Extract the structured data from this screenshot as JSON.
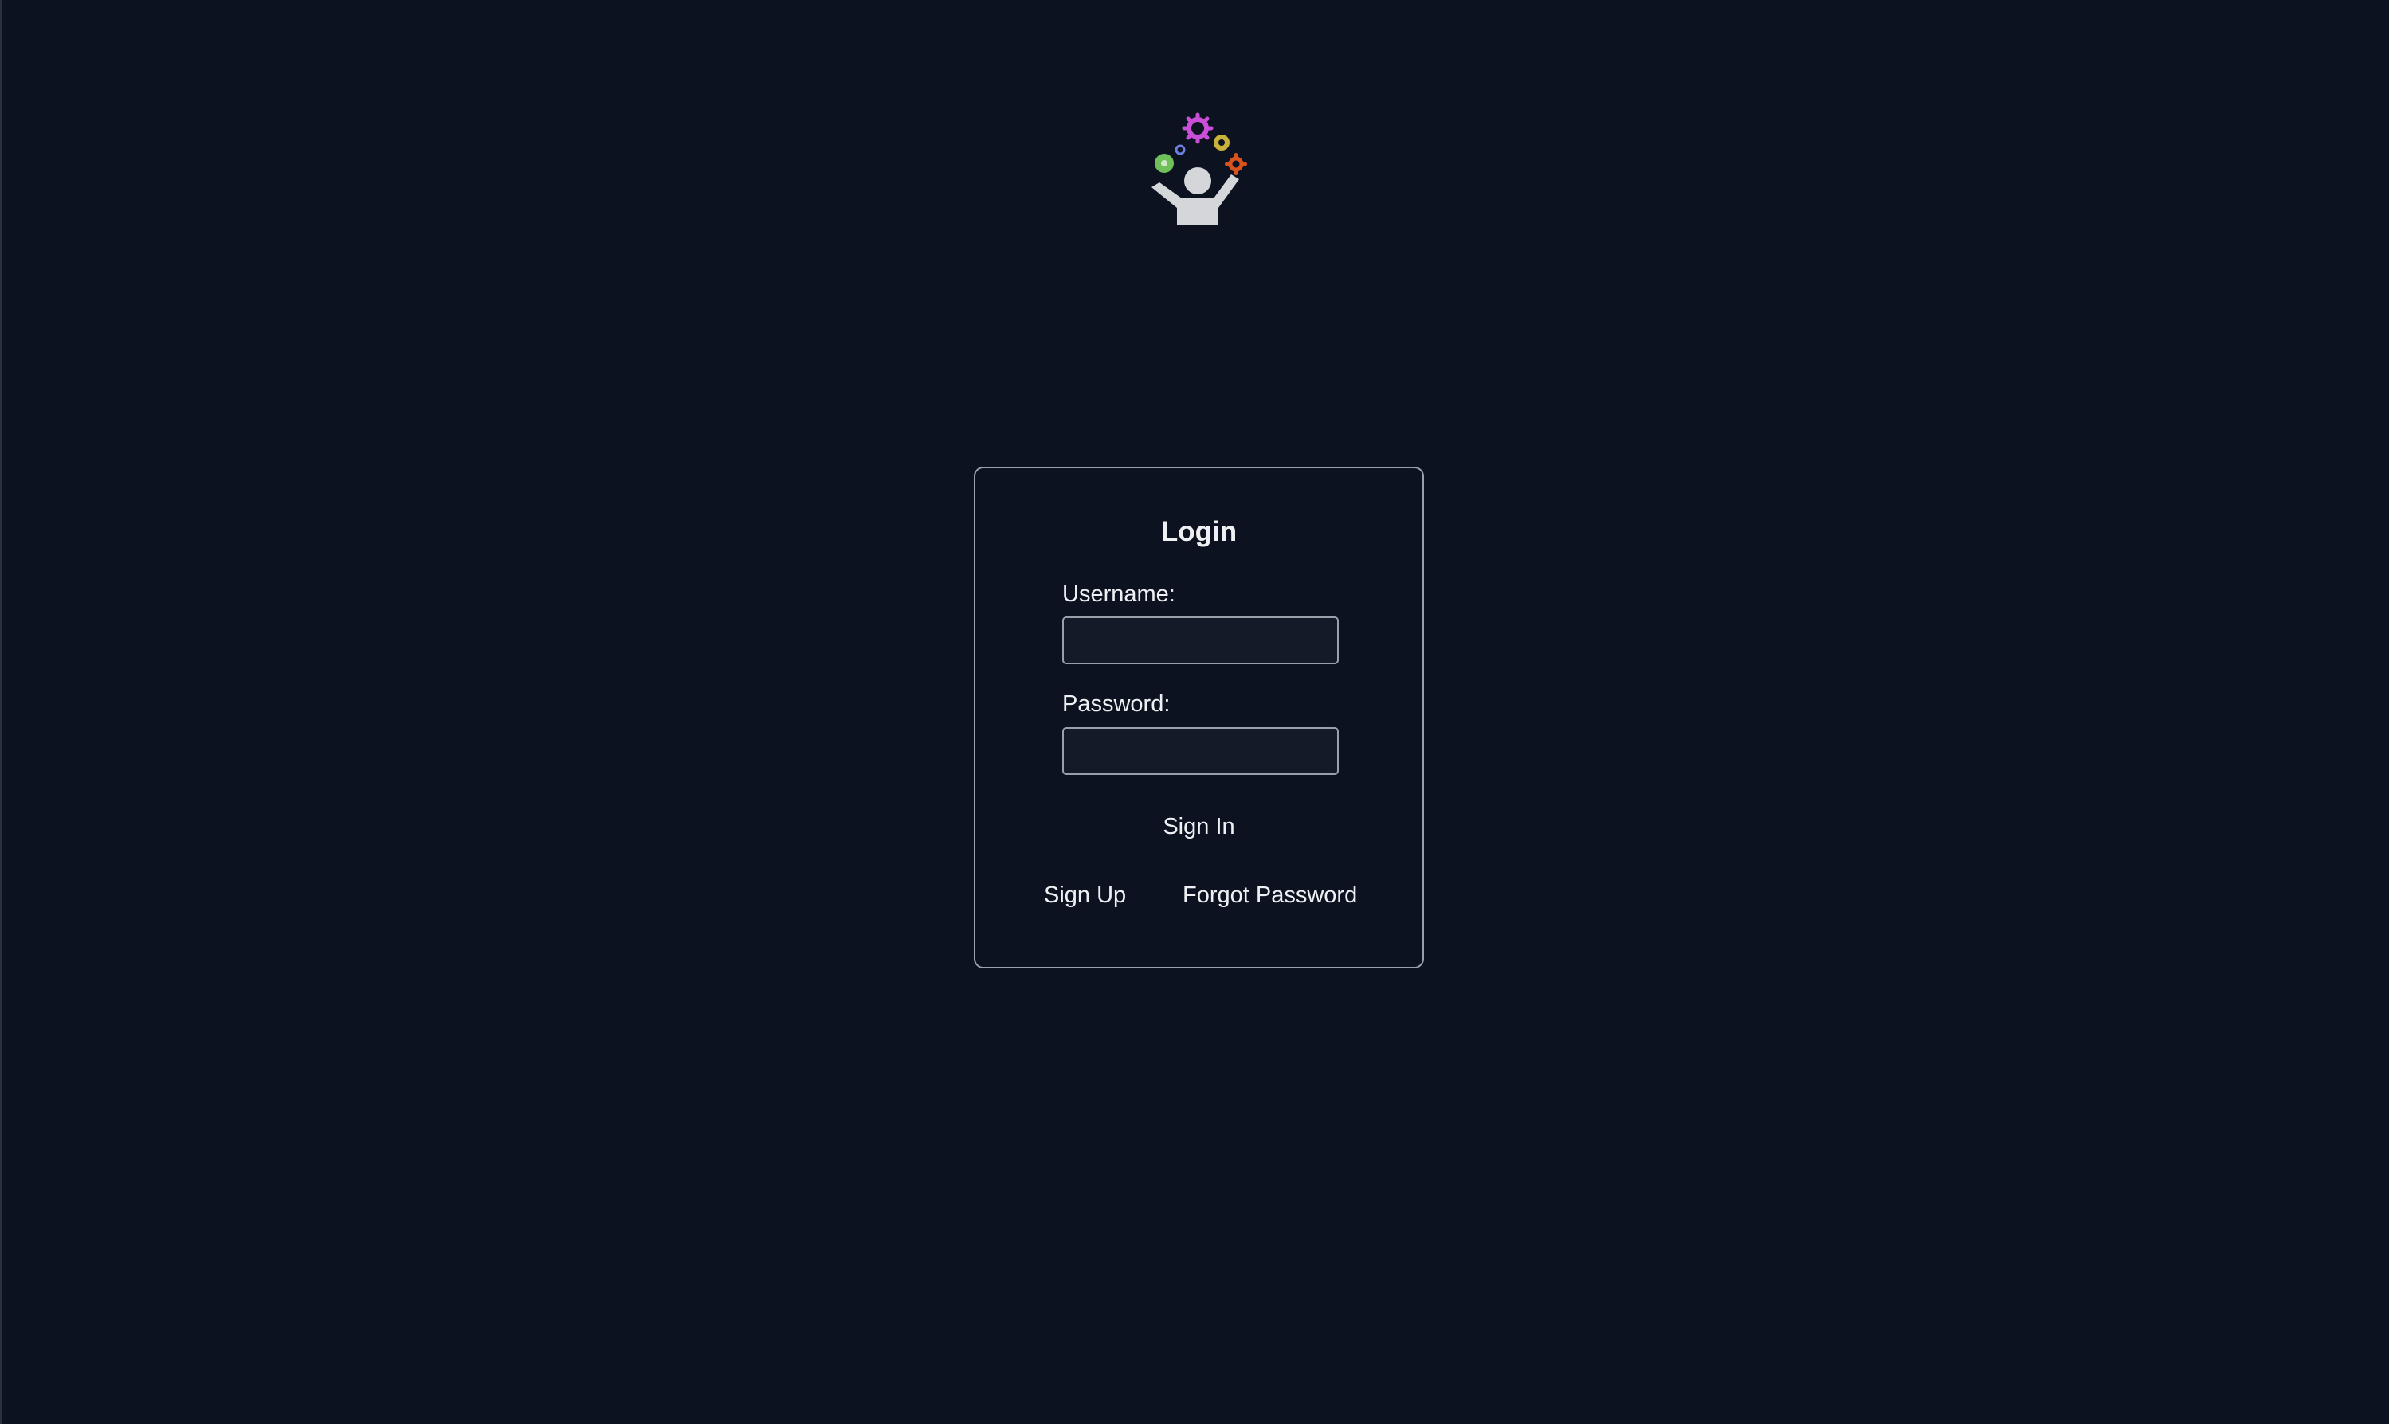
{
  "colors": {
    "background": "#0c1220",
    "card_border": "#9aa0aa",
    "input_background": "#141a28",
    "text": "#eef0f3"
  },
  "logo": {
    "icon": "person-juggling-gears-icon"
  },
  "login": {
    "title": "Login",
    "username_label": "Username:",
    "username_value": "",
    "password_label": "Password:",
    "password_value": "",
    "sign_in_label": "Sign In",
    "sign_up_label": "Sign Up",
    "forgot_password_label": "Forgot Password"
  }
}
